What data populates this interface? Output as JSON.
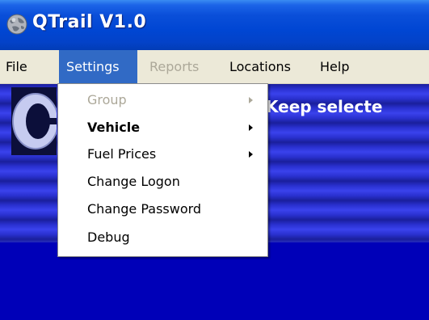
{
  "window": {
    "title": "QTrail V1.0"
  },
  "icons": {
    "app": "globe-icon",
    "logo": "app-logo",
    "submenu": "chevron-right-icon",
    "check": "checkmark-icon"
  },
  "menubar": {
    "items": [
      {
        "label": "File"
      },
      {
        "label": "Settings"
      },
      {
        "label": "Reports"
      },
      {
        "label": "Locations"
      },
      {
        "label": "Help"
      }
    ]
  },
  "settings_menu": {
    "items": [
      {
        "label": "Group"
      },
      {
        "label": "Vehicle"
      },
      {
        "label": "Fuel Prices"
      },
      {
        "label": "Change Logon"
      },
      {
        "label": "Change Password"
      },
      {
        "label": "Debug"
      }
    ]
  },
  "main": {
    "keep_selected_label": "Keep selecte"
  },
  "colors": {
    "menu_highlight": "#316ac5",
    "titlebar": "#0046d3",
    "client_blue": "#2a31d0",
    "disabled_text": "#aca899"
  }
}
